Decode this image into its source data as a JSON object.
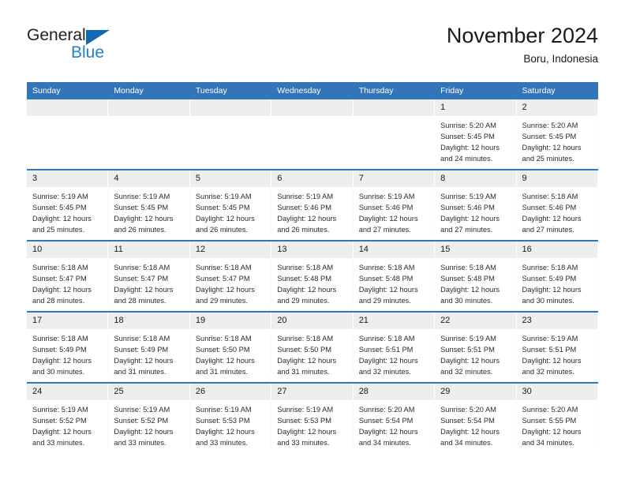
{
  "brand": {
    "name_part1": "General",
    "name_part2": "Blue",
    "triangle_color": "#1268b3",
    "blue_color": "#1f83d0"
  },
  "header": {
    "title": "November 2024",
    "location": "Boru, Indonesia"
  },
  "theme": {
    "header_blue": "#3275b8",
    "daynum_gray": "#eeeeee",
    "text": "#1a1a1a"
  },
  "weekdays": [
    "Sunday",
    "Monday",
    "Tuesday",
    "Wednesday",
    "Thursday",
    "Friday",
    "Saturday"
  ],
  "weeks": [
    [
      {
        "day": "",
        "blank": true
      },
      {
        "day": "",
        "blank": true
      },
      {
        "day": "",
        "blank": true
      },
      {
        "day": "",
        "blank": true
      },
      {
        "day": "",
        "blank": true
      },
      {
        "day": "1",
        "sunrise": "Sunrise: 5:20 AM",
        "sunset": "Sunset: 5:45 PM",
        "daylight": "Daylight: 12 hours and 24 minutes."
      },
      {
        "day": "2",
        "sunrise": "Sunrise: 5:20 AM",
        "sunset": "Sunset: 5:45 PM",
        "daylight": "Daylight: 12 hours and 25 minutes."
      }
    ],
    [
      {
        "day": "3",
        "sunrise": "Sunrise: 5:19 AM",
        "sunset": "Sunset: 5:45 PM",
        "daylight": "Daylight: 12 hours and 25 minutes."
      },
      {
        "day": "4",
        "sunrise": "Sunrise: 5:19 AM",
        "sunset": "Sunset: 5:45 PM",
        "daylight": "Daylight: 12 hours and 26 minutes."
      },
      {
        "day": "5",
        "sunrise": "Sunrise: 5:19 AM",
        "sunset": "Sunset: 5:45 PM",
        "daylight": "Daylight: 12 hours and 26 minutes."
      },
      {
        "day": "6",
        "sunrise": "Sunrise: 5:19 AM",
        "sunset": "Sunset: 5:46 PM",
        "daylight": "Daylight: 12 hours and 26 minutes."
      },
      {
        "day": "7",
        "sunrise": "Sunrise: 5:19 AM",
        "sunset": "Sunset: 5:46 PM",
        "daylight": "Daylight: 12 hours and 27 minutes."
      },
      {
        "day": "8",
        "sunrise": "Sunrise: 5:19 AM",
        "sunset": "Sunset: 5:46 PM",
        "daylight": "Daylight: 12 hours and 27 minutes."
      },
      {
        "day": "9",
        "sunrise": "Sunrise: 5:18 AM",
        "sunset": "Sunset: 5:46 PM",
        "daylight": "Daylight: 12 hours and 27 minutes."
      }
    ],
    [
      {
        "day": "10",
        "sunrise": "Sunrise: 5:18 AM",
        "sunset": "Sunset: 5:47 PM",
        "daylight": "Daylight: 12 hours and 28 minutes."
      },
      {
        "day": "11",
        "sunrise": "Sunrise: 5:18 AM",
        "sunset": "Sunset: 5:47 PM",
        "daylight": "Daylight: 12 hours and 28 minutes."
      },
      {
        "day": "12",
        "sunrise": "Sunrise: 5:18 AM",
        "sunset": "Sunset: 5:47 PM",
        "daylight": "Daylight: 12 hours and 29 minutes."
      },
      {
        "day": "13",
        "sunrise": "Sunrise: 5:18 AM",
        "sunset": "Sunset: 5:48 PM",
        "daylight": "Daylight: 12 hours and 29 minutes."
      },
      {
        "day": "14",
        "sunrise": "Sunrise: 5:18 AM",
        "sunset": "Sunset: 5:48 PM",
        "daylight": "Daylight: 12 hours and 29 minutes."
      },
      {
        "day": "15",
        "sunrise": "Sunrise: 5:18 AM",
        "sunset": "Sunset: 5:48 PM",
        "daylight": "Daylight: 12 hours and 30 minutes."
      },
      {
        "day": "16",
        "sunrise": "Sunrise: 5:18 AM",
        "sunset": "Sunset: 5:49 PM",
        "daylight": "Daylight: 12 hours and 30 minutes."
      }
    ],
    [
      {
        "day": "17",
        "sunrise": "Sunrise: 5:18 AM",
        "sunset": "Sunset: 5:49 PM",
        "daylight": "Daylight: 12 hours and 30 minutes."
      },
      {
        "day": "18",
        "sunrise": "Sunrise: 5:18 AM",
        "sunset": "Sunset: 5:49 PM",
        "daylight": "Daylight: 12 hours and 31 minutes."
      },
      {
        "day": "19",
        "sunrise": "Sunrise: 5:18 AM",
        "sunset": "Sunset: 5:50 PM",
        "daylight": "Daylight: 12 hours and 31 minutes."
      },
      {
        "day": "20",
        "sunrise": "Sunrise: 5:18 AM",
        "sunset": "Sunset: 5:50 PM",
        "daylight": "Daylight: 12 hours and 31 minutes."
      },
      {
        "day": "21",
        "sunrise": "Sunrise: 5:18 AM",
        "sunset": "Sunset: 5:51 PM",
        "daylight": "Daylight: 12 hours and 32 minutes."
      },
      {
        "day": "22",
        "sunrise": "Sunrise: 5:19 AM",
        "sunset": "Sunset: 5:51 PM",
        "daylight": "Daylight: 12 hours and 32 minutes."
      },
      {
        "day": "23",
        "sunrise": "Sunrise: 5:19 AM",
        "sunset": "Sunset: 5:51 PM",
        "daylight": "Daylight: 12 hours and 32 minutes."
      }
    ],
    [
      {
        "day": "24",
        "sunrise": "Sunrise: 5:19 AM",
        "sunset": "Sunset: 5:52 PM",
        "daylight": "Daylight: 12 hours and 33 minutes."
      },
      {
        "day": "25",
        "sunrise": "Sunrise: 5:19 AM",
        "sunset": "Sunset: 5:52 PM",
        "daylight": "Daylight: 12 hours and 33 minutes."
      },
      {
        "day": "26",
        "sunrise": "Sunrise: 5:19 AM",
        "sunset": "Sunset: 5:53 PM",
        "daylight": "Daylight: 12 hours and 33 minutes."
      },
      {
        "day": "27",
        "sunrise": "Sunrise: 5:19 AM",
        "sunset": "Sunset: 5:53 PM",
        "daylight": "Daylight: 12 hours and 33 minutes."
      },
      {
        "day": "28",
        "sunrise": "Sunrise: 5:20 AM",
        "sunset": "Sunset: 5:54 PM",
        "daylight": "Daylight: 12 hours and 34 minutes."
      },
      {
        "day": "29",
        "sunrise": "Sunrise: 5:20 AM",
        "sunset": "Sunset: 5:54 PM",
        "daylight": "Daylight: 12 hours and 34 minutes."
      },
      {
        "day": "30",
        "sunrise": "Sunrise: 5:20 AM",
        "sunset": "Sunset: 5:55 PM",
        "daylight": "Daylight: 12 hours and 34 minutes."
      }
    ]
  ]
}
